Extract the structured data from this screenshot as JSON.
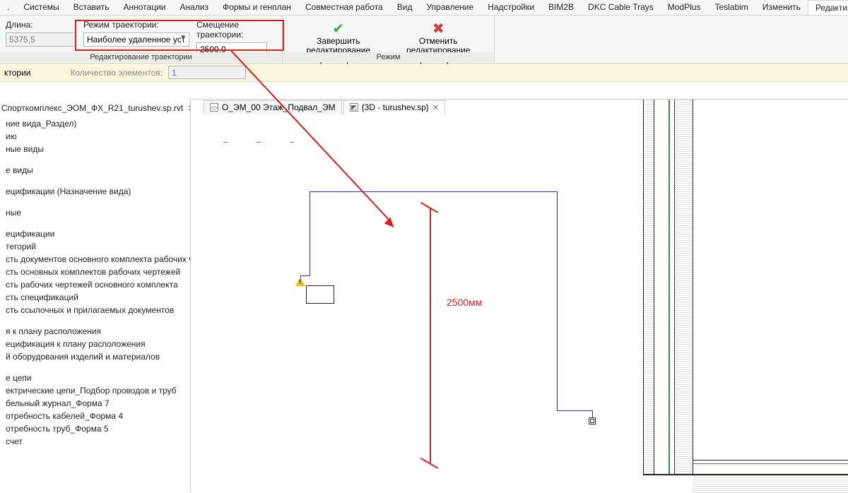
{
  "ribbon_tabs": {
    "t0": ".",
    "t1": "Системы",
    "t2": "Вставить",
    "t3": "Аннотации",
    "t4": "Анализ",
    "t5": "Формы и генплан",
    "t6": "Совместная работа",
    "t7": "Вид",
    "t8": "Управление",
    "t9": "Надстройки",
    "t10": "BIM2B",
    "t11": "DKC Cable Trays",
    "t12": "ModPlus",
    "t13": "Teslabim",
    "t14": "Изменить",
    "t15": "Редактирование траектории"
  },
  "ribbon": {
    "length_label": "Длина:",
    "length_value": "5375,5",
    "mode_label": "Режим траектории:",
    "mode_value": "Наиболее удаленное уст…",
    "offset_label": "Смещение траектории:",
    "offset_value": "2500,0",
    "finish_l1": "Завершить",
    "finish_l2": "редактирование траектории",
    "cancel_l1": "Отменить",
    "cancel_l2": "редактирование траектории",
    "group_left": "Редактирование траектории",
    "group_right": "Режим"
  },
  "options": {
    "label1": "ктории",
    "count_label": "Количество элементов:",
    "count_value": "1"
  },
  "browser": {
    "file": "Спорткомплекс_ЭОМ_ФХ_R21_turushev.sp.rvt",
    "r0": "ние вида_Раздел)",
    "r1": "ию",
    "r2": "ные виды",
    "r3": "е виды",
    "r4": "ецификации (Назначение вида)",
    "r5": "ные",
    "r6": "ецификации",
    "r7": "тегорий",
    "r8": "сть документов основного комплекта рабочих че",
    "r9": "сть основных комплектов рабочих чертежей",
    "r10": "сть рабочих чертежей основного комплекта",
    "r11": "сть спецификаций",
    "r12": "сть ссылочных и прилагаемых документов",
    "r13": "я к плану расположения",
    "r14": "ецификация к плану расположения",
    "r15": "й оборудования изделий и материалов",
    "r16": "е цепи",
    "r17": "ектрические цепи_Подбор проводов и труб",
    "r18": "бельный журнал_Форма 7",
    "r19": "отребность кабелей_Форма 4",
    "r20": "отребность труб_Форма 5",
    "r21": "счет"
  },
  "doc_tabs": {
    "tab1": "О_ЭМ_00 Этаж_Подвал_ЭМ",
    "tab2": "{3D - turushev.sp}"
  },
  "annotation": {
    "dim_text": "2500мм"
  }
}
